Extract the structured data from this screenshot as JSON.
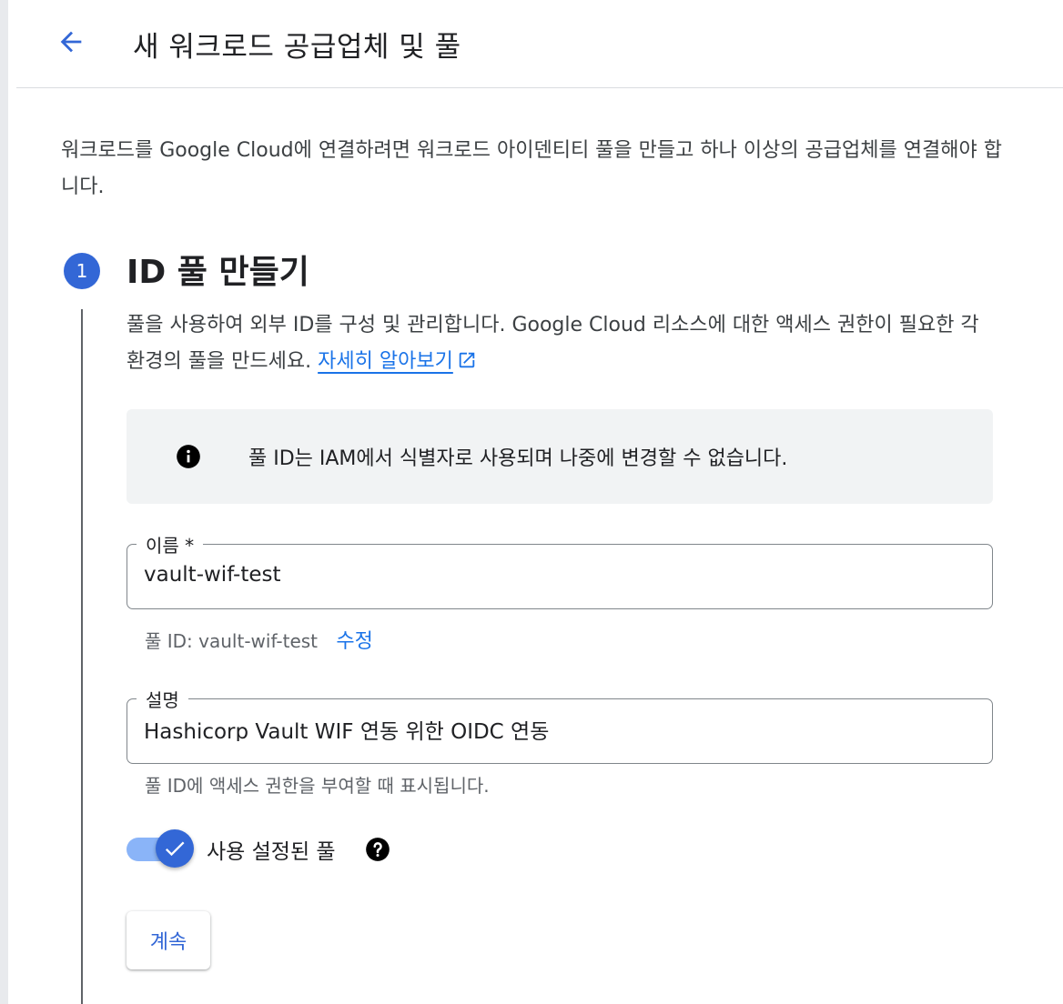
{
  "header": {
    "title": "새 워크로드 공급업체 및 풀",
    "back_icon": "arrow-back-icon"
  },
  "intro": "워크로드를 Google Cloud에 연결하려면 워크로드 아이덴티티 풀을 만들고 하나 이상의 공급업체를 연결해야 합니다.",
  "step": {
    "number": "1",
    "title": "ID 풀 만들기",
    "description": "풀을 사용하여 외부 ID를 구성 및 관리합니다. Google Cloud 리소스에 대한 액세스 권한이 필요한 각 환경의 풀을 만드세요.",
    "learn_more": "자세히 알아보기"
  },
  "info": {
    "icon": "info-icon",
    "text": "풀 ID는 IAM에서 식별자로 사용되며 나중에 변경할 수 없습니다."
  },
  "name_field": {
    "label": "이름 *",
    "value": "vault-wif-test",
    "hint": "풀 ID: vault-wif-test",
    "edit_label": "수정"
  },
  "description_field": {
    "label": "설명",
    "value": "Hashicorp Vault WIF 연동 위한 OIDC 연동",
    "hint": "풀 ID에 액세스 권한을 부여할 때 표시됩니다."
  },
  "enabled_toggle": {
    "label": "사용 설정된 풀",
    "checked": true,
    "help_icon": "help-icon"
  },
  "continue_label": "계속",
  "colors": {
    "accent": "#1a73e8",
    "badge": "#3367d6",
    "info_bg": "#f1f3f4"
  }
}
